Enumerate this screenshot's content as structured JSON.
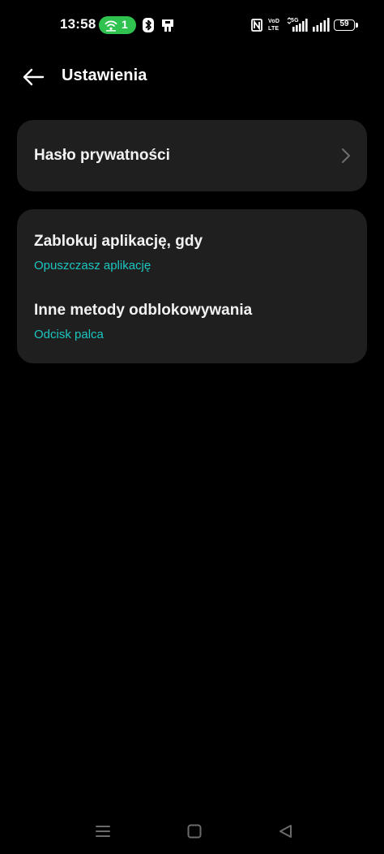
{
  "status_bar": {
    "time": "13:58",
    "hotspot_count": "1",
    "battery_level": "59",
    "nfc_label": "N",
    "volte_label_top": "VoD",
    "volte_label_bottom": "LTE",
    "network_label": "5G",
    "icons": [
      "hotspot-icon",
      "bluetooth-icon",
      "sim-toolkit-icon",
      "nfc-icon",
      "volte-icon",
      "signal-5g-icon",
      "signal-icon",
      "battery-icon"
    ]
  },
  "header": {
    "title": "Ustawienia",
    "back_icon": "arrow-left-icon"
  },
  "cards": [
    {
      "rows": [
        {
          "title": "Hasło prywatności",
          "chevron_icon": "chevron-right-icon"
        }
      ]
    },
    {
      "rows": [
        {
          "title": "Zablokuj aplikację, gdy",
          "subtitle": "Opuszczasz aplikację"
        },
        {
          "title": "Inne metody odblokowywania",
          "subtitle": "Odcisk palca"
        }
      ]
    }
  ],
  "nav_bar": {
    "icons": [
      "menu-icon",
      "home-square-icon",
      "back-triangle-icon"
    ]
  },
  "colors": {
    "background": "#000000",
    "card": "#1f1f1f",
    "accent": "#1cc6c0",
    "hotspot": "#2fc24f",
    "text_primary": "#f2f2f2",
    "nav_icon": "#6b6b6b"
  }
}
